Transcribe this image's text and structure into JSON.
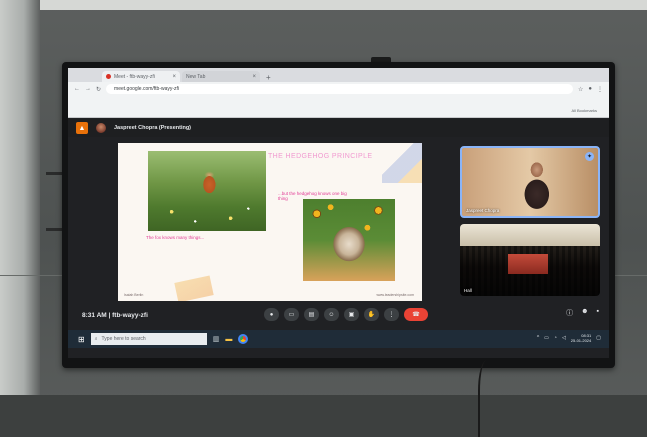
{
  "browser": {
    "tabs": [
      {
        "title": "Meet - ftb-wayy-zfi",
        "recording": true
      },
      {
        "title": "New Tab",
        "recording": false
      }
    ],
    "url": "meet.google.com/ftb-wayy-zfi",
    "bookmarks_label": "All Bookmarks"
  },
  "meet": {
    "presenter": "Jaspreet Chopra (Presenting)",
    "slide": {
      "title": "THE HEDGEHOG PRINCIPLE",
      "fox_caption": "The fox knows many things...",
      "hedgehog_caption": "...but the hedgehog knows one big thing",
      "footnote": "Isaiah Berlin",
      "url": "www.leadershipsite.com"
    },
    "participants": [
      {
        "name": "Jaspreet Chopra"
      },
      {
        "name": "Hall"
      }
    ],
    "time": "8:31 AM",
    "meeting_code": "ftb-wayy-zfi",
    "controls": [
      "mic-icon",
      "camera-icon",
      "captions-icon",
      "emoji-icon",
      "present-icon",
      "raise-hand-icon",
      "more-icon",
      "hangup-icon"
    ],
    "right_controls": [
      "info-icon",
      "people-icon",
      "chat-icon"
    ]
  },
  "taskbar": {
    "search_placeholder": "Type here to search",
    "time": "08:31",
    "date": "25-01-2024"
  },
  "colors": {
    "accent": "#8ab4f8",
    "hangup": "#ea4335",
    "slide_pink": "#e23c96",
    "taskbar": "#1f2c38"
  }
}
